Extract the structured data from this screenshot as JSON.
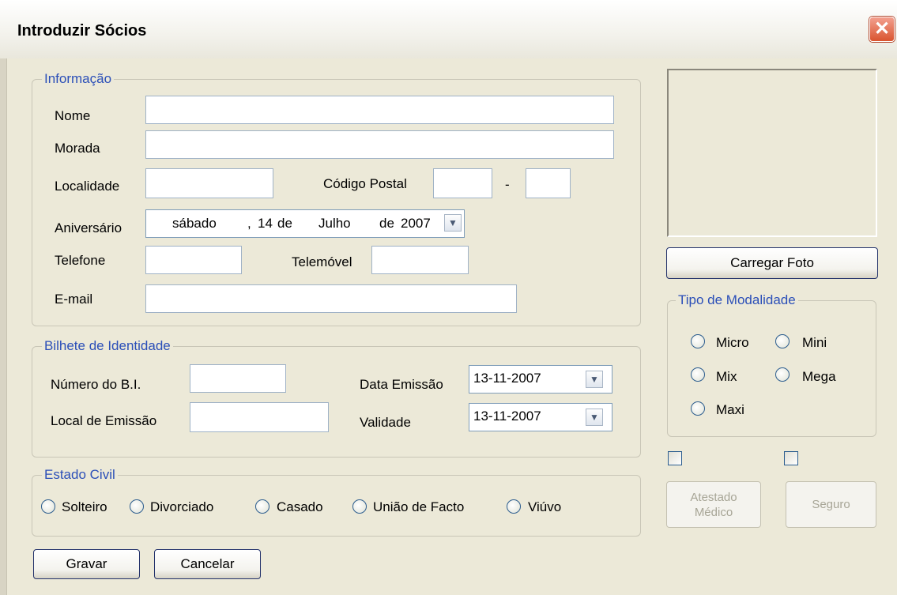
{
  "window": {
    "title": "Introduzir Sócios",
    "close_symbol": "✕"
  },
  "informacao": {
    "legend": "Informação",
    "nome_label": "Nome",
    "nome_value": "",
    "morada_label": "Morada",
    "morada_value": "",
    "localidade_label": "Localidade",
    "localidade_value": "",
    "codigo_postal_label": "Código Postal",
    "codigo_postal_part1": "",
    "codigo_postal_sep": "-",
    "codigo_postal_part2": "",
    "aniversario_label": "Aniversário",
    "aniversario_weekday": "sábado",
    "aniversario_comma": ",",
    "aniversario_day": "14",
    "aniversario_de1": "de",
    "aniversario_month": "Julho",
    "aniversario_de2": "de",
    "aniversario_year": "2007",
    "telefone_label": "Telefone",
    "telefone_value": "",
    "telemovel_label": "Telemóvel",
    "telemovel_value": "",
    "email_label": "E-mail",
    "email_value": ""
  },
  "bilhete": {
    "legend": "Bilhete de Identidade",
    "numero_label": "Número do B.I.",
    "numero_value": "",
    "local_label": "Local de Emissão",
    "local_value": "",
    "data_emissao_label": "Data Emissão",
    "data_emissao_value": "13-11-2007",
    "validade_label": "Validade",
    "validade_value": "13-11-2007"
  },
  "estado_civil": {
    "legend": "Estado Civil",
    "options": [
      "Solteiro",
      "Divorciado",
      "Casado",
      "União de Facto",
      "Viúvo"
    ]
  },
  "foto": {
    "button_label": "Carregar Foto"
  },
  "modalidade": {
    "legend": "Tipo de Modalidade",
    "options": [
      "Micro",
      "Mini",
      "Mix",
      "Mega",
      "Maxi"
    ]
  },
  "atestado": {
    "line1": "Atestado",
    "line2": "Médico"
  },
  "seguro": {
    "label": "Seguro"
  },
  "actions": {
    "gravar": "Gravar",
    "cancelar": "Cancelar"
  },
  "icons": {
    "dropdown": "chevron-down-icon",
    "close": "close-icon"
  }
}
